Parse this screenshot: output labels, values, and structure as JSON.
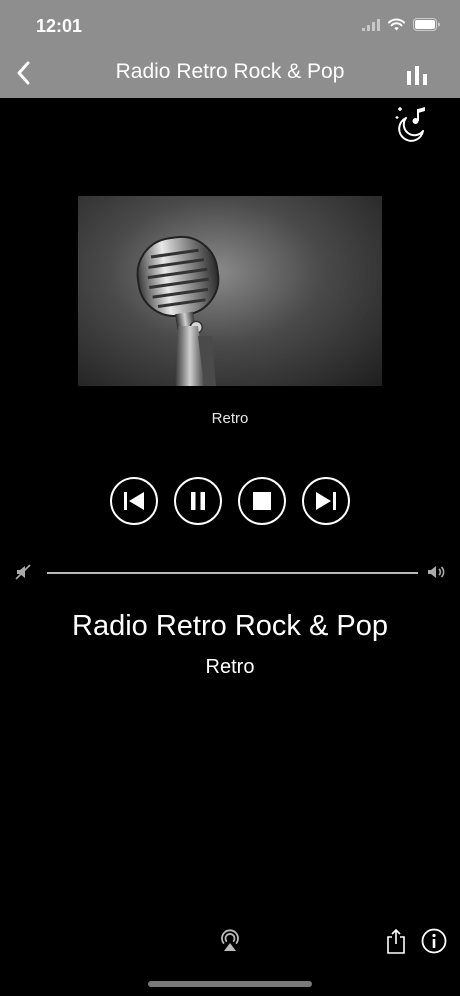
{
  "status_bar": {
    "time": "12:01",
    "icons": [
      "signal-icon",
      "wifi-icon",
      "battery-icon"
    ]
  },
  "nav": {
    "title": "Radio Retro Rock & Pop",
    "back_icon": "chevron-left-icon",
    "right_icon": "equalizer-icon"
  },
  "sleep_timer": {
    "icon": "sleep-timer-moon-music-icon"
  },
  "artwork": {
    "subject": "vintage-microphone",
    "caption": "Retro"
  },
  "controls": {
    "buttons": [
      "previous-icon",
      "pause-icon",
      "stop-icon",
      "next-icon"
    ]
  },
  "volume": {
    "level": 1.0
  },
  "now_playing": {
    "station": "Radio Retro Rock & Pop",
    "genre": "Retro"
  },
  "bottom_bar": {
    "icons": [
      "airplay-icon",
      "share-icon",
      "info-icon"
    ]
  },
  "colors": {
    "header_bg": "#8e8e8e",
    "background": "#000000",
    "foreground": "#ffffff"
  }
}
